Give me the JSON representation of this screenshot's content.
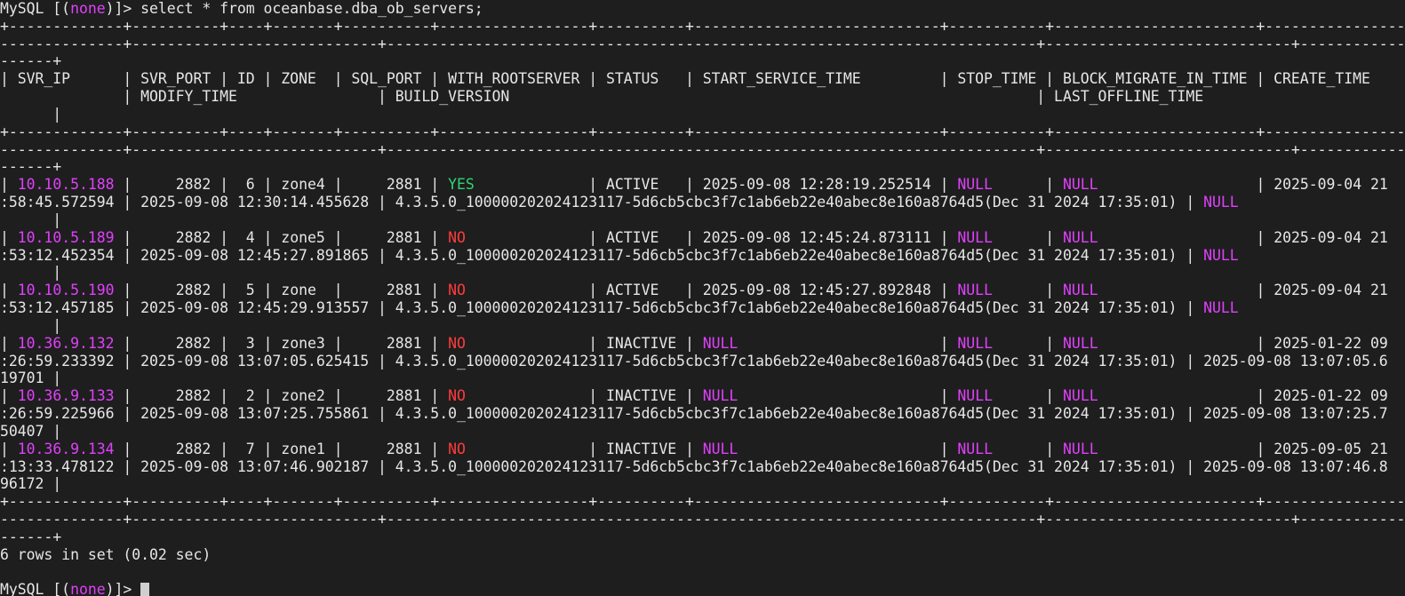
{
  "terminal": {
    "colors": {
      "background": "#1e1e1e",
      "text": "#e6e6e6",
      "magenta": "#e040fb",
      "green": "#2ed573",
      "red": "#ff3b3b",
      "cursor": "#cfcfcf"
    },
    "lines": [
      [
        {
          "t": "MySQL [("
        },
        {
          "t": "none",
          "c": "magenta"
        },
        {
          "t": ")]> select * from oceanbase.dba_ob_servers;"
        }
      ],
      [
        {
          "t": "+-------------+----------+----+-------+----------+-----------------+----------+----------------------------+-----------+-----------------------+----------------------------"
        }
      ],
      [
        {
          "t": "--------------+----------------------------+--------------------------------------------------------------------------+----------------------------+-----------------------------"
        }
      ],
      [
        {
          "t": "------+"
        }
      ],
      [
        {
          "t": "| SVR_IP      | SVR_PORT | ID | ZONE  | SQL_PORT | WITH_ROOTSERVER | STATUS   | START_SERVICE_TIME         | STOP_TIME | BLOCK_MIGRATE_IN_TIME | CREATE_TIME"
        }
      ],
      [
        {
          "t": "              | MODIFY_TIME                | BUILD_VERSION                                                            | LAST_OFFLINE_TIME"
        }
      ],
      [
        {
          "t": "      |"
        }
      ],
      [
        {
          "t": "+-------------+----------+----+-------+----------+-----------------+----------+----------------------------+-----------+-----------------------+----------------------------"
        }
      ],
      [
        {
          "t": "--------------+----------------------------+--------------------------------------------------------------------------+----------------------------+-----------------------------"
        }
      ],
      [
        {
          "t": "------+"
        }
      ],
      [
        {
          "t": "| "
        },
        {
          "t": "10.10.5.188",
          "c": "magenta"
        },
        {
          "t": " |     2882 |  6 | zone4 |     2881 | "
        },
        {
          "t": "YES",
          "c": "green"
        },
        {
          "t": "             | ACTIVE   | 2025-09-08 12:28:19.252514 | "
        },
        {
          "t": "NULL",
          "c": "magenta"
        },
        {
          "t": "      | "
        },
        {
          "t": "NULL",
          "c": "magenta"
        },
        {
          "t": "                  | 2025-09-04 21"
        }
      ],
      [
        {
          "t": ":58:45.572594 | 2025-09-08 12:30:14.455628 | 4.3.5.0_100000202024123117-5d6cb5cbc3f7c1ab6eb22e40abec8e160a8764d5(Dec 31 2024 17:35:01) | "
        },
        {
          "t": "NULL",
          "c": "magenta"
        }
      ],
      [
        {
          "t": "      |"
        }
      ],
      [
        {
          "t": "| "
        },
        {
          "t": "10.10.5.189",
          "c": "magenta"
        },
        {
          "t": " |     2882 |  4 | zone5 |     2881 | "
        },
        {
          "t": "NO",
          "c": "red"
        },
        {
          "t": "              | ACTIVE   | 2025-09-08 12:45:24.873111 | "
        },
        {
          "t": "NULL",
          "c": "magenta"
        },
        {
          "t": "      | "
        },
        {
          "t": "NULL",
          "c": "magenta"
        },
        {
          "t": "                  | 2025-09-04 21"
        }
      ],
      [
        {
          "t": ":53:12.452354 | 2025-09-08 12:45:27.891865 | 4.3.5.0_100000202024123117-5d6cb5cbc3f7c1ab6eb22e40abec8e160a8764d5(Dec 31 2024 17:35:01) | "
        },
        {
          "t": "NULL",
          "c": "magenta"
        }
      ],
      [
        {
          "t": "      |"
        }
      ],
      [
        {
          "t": "| "
        },
        {
          "t": "10.10.5.190",
          "c": "magenta"
        },
        {
          "t": " |     2882 |  5 | zone  |     2881 | "
        },
        {
          "t": "NO",
          "c": "red"
        },
        {
          "t": "              | ACTIVE   | 2025-09-08 12:45:27.892848 | "
        },
        {
          "t": "NULL",
          "c": "magenta"
        },
        {
          "t": "      | "
        },
        {
          "t": "NULL",
          "c": "magenta"
        },
        {
          "t": "                  | 2025-09-04 21"
        }
      ],
      [
        {
          "t": ":53:12.457185 | 2025-09-08 12:45:29.913557 | 4.3.5.0_100000202024123117-5d6cb5cbc3f7c1ab6eb22e40abec8e160a8764d5(Dec 31 2024 17:35:01) | "
        },
        {
          "t": "NULL",
          "c": "magenta"
        }
      ],
      [
        {
          "t": "      |"
        }
      ],
      [
        {
          "t": "| "
        },
        {
          "t": "10.36.9.132",
          "c": "magenta"
        },
        {
          "t": " |     2882 |  3 | zone3 |     2881 | "
        },
        {
          "t": "NO",
          "c": "red"
        },
        {
          "t": "              | INACTIVE | "
        },
        {
          "t": "NULL",
          "c": "magenta"
        },
        {
          "t": "                       | "
        },
        {
          "t": "NULL",
          "c": "magenta"
        },
        {
          "t": "      | "
        },
        {
          "t": "NULL",
          "c": "magenta"
        },
        {
          "t": "                  | 2025-01-22 09"
        }
      ],
      [
        {
          "t": ":26:59.233392 | 2025-09-08 13:07:05.625415 | 4.3.5.0_100000202024123117-5d6cb5cbc3f7c1ab6eb22e40abec8e160a8764d5(Dec 31 2024 17:35:01) | 2025-09-08 13:07:05.6"
        }
      ],
      [
        {
          "t": "19701 |"
        }
      ],
      [
        {
          "t": "| "
        },
        {
          "t": "10.36.9.133",
          "c": "magenta"
        },
        {
          "t": " |     2882 |  2 | zone2 |     2881 | "
        },
        {
          "t": "NO",
          "c": "red"
        },
        {
          "t": "              | INACTIVE | "
        },
        {
          "t": "NULL",
          "c": "magenta"
        },
        {
          "t": "                       | "
        },
        {
          "t": "NULL",
          "c": "magenta"
        },
        {
          "t": "      | "
        },
        {
          "t": "NULL",
          "c": "magenta"
        },
        {
          "t": "                  | 2025-01-22 09"
        }
      ],
      [
        {
          "t": ":26:59.225966 | 2025-09-08 13:07:25.755861 | 4.3.5.0_100000202024123117-5d6cb5cbc3f7c1ab6eb22e40abec8e160a8764d5(Dec 31 2024 17:35:01) | 2025-09-08 13:07:25.7"
        }
      ],
      [
        {
          "t": "50407 |"
        }
      ],
      [
        {
          "t": "| "
        },
        {
          "t": "10.36.9.134",
          "c": "magenta"
        },
        {
          "t": " |     2882 |  7 | zone1 |     2881 | "
        },
        {
          "t": "NO",
          "c": "red"
        },
        {
          "t": "              | INACTIVE | "
        },
        {
          "t": "NULL",
          "c": "magenta"
        },
        {
          "t": "                       | "
        },
        {
          "t": "NULL",
          "c": "magenta"
        },
        {
          "t": "      | "
        },
        {
          "t": "NULL",
          "c": "magenta"
        },
        {
          "t": "                  | 2025-09-05 21"
        }
      ],
      [
        {
          "t": ":13:33.478122 | 2025-09-08 13:07:46.902187 | 4.3.5.0_100000202024123117-5d6cb5cbc3f7c1ab6eb22e40abec8e160a8764d5(Dec 31 2024 17:35:01) | 2025-09-08 13:07:46.8"
        }
      ],
      [
        {
          "t": "96172 |"
        }
      ],
      [
        {
          "t": "+-------------+----------+----+-------+----------+-----------------+----------+----------------------------+-----------+-----------------------+----------------------------"
        }
      ],
      [
        {
          "t": "--------------+----------------------------+--------------------------------------------------------------------------+----------------------------+-----------------------------"
        }
      ],
      [
        {
          "t": "------+"
        }
      ],
      [
        {
          "t": "6 rows in set (0.02 sec)"
        }
      ],
      [
        {
          "t": ""
        }
      ],
      [
        {
          "t": "MySQL [("
        },
        {
          "t": "none",
          "c": "magenta"
        },
        {
          "t": ")]> "
        },
        {
          "cursor": true
        }
      ]
    ]
  }
}
